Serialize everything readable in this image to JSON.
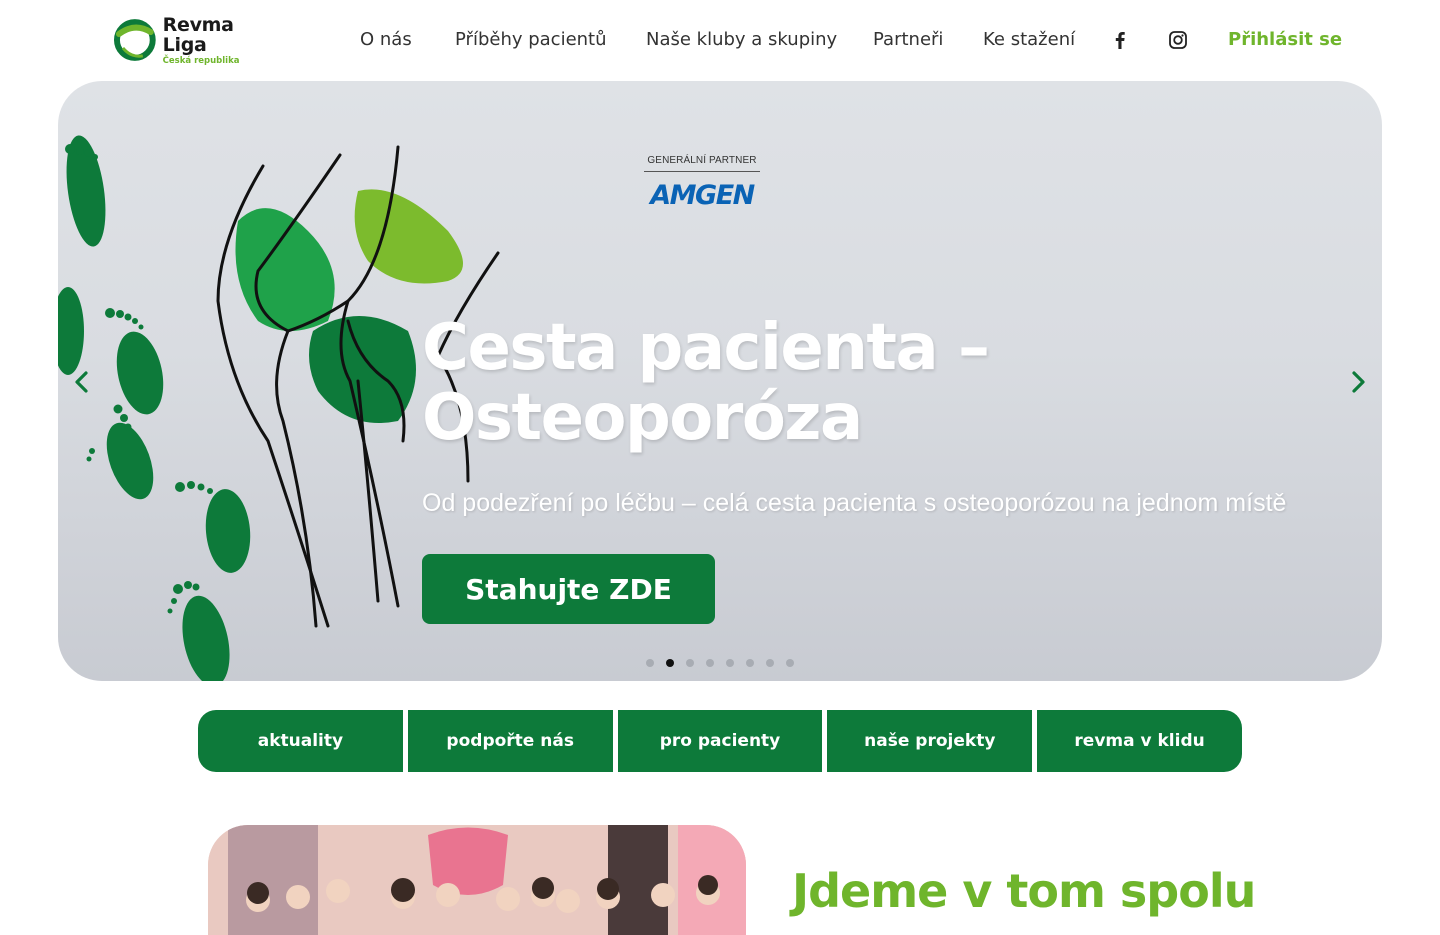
{
  "logo": {
    "title": "Revma Liga",
    "subtitle": "Česká republika",
    "icon": "revma-liga-ring-logo"
  },
  "nav": {
    "items": [
      "O nás",
      "Příběhy pacientů",
      "Naše kluby a skupiny",
      "Partneři",
      "Ke stažení"
    ],
    "social": [
      "facebook-icon",
      "instagram-icon"
    ],
    "login": "Přihlásit se"
  },
  "hero": {
    "partner_label": "GENERÁLNÍ PARTNER",
    "partner_brand": "AMGEN",
    "title_line1": "Cesta pacienta –",
    "title_line2": "Osteoporóza",
    "subtitle": "Od podezření po léčbu – celá cesta pacienta s osteoporózou na jednom místě",
    "button": "Stahujte ZDE",
    "slides_total": 8,
    "active_slide": 2
  },
  "tabs": [
    "aktuality",
    "podpořte nás",
    "pro pacienty",
    "naše projekty",
    "revma v klidu"
  ],
  "section": {
    "headline": "Jdeme v tom spolu"
  },
  "colors": {
    "brand_green": "#0d7a3a",
    "accent_green": "#6fb52c",
    "partner_blue": "#0a63b5"
  }
}
